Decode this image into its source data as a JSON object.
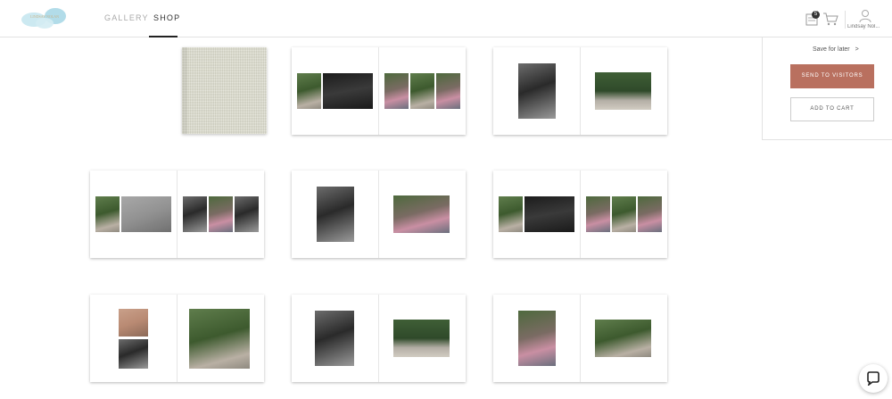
{
  "brand": {
    "logo_text": "LINDSAY NOLAN"
  },
  "nav": {
    "items": [
      {
        "label": "GALLERY"
      },
      {
        "label": "SHOP"
      }
    ]
  },
  "header": {
    "favorites_count": "5",
    "user_name": "Lindsay Nol..."
  },
  "sidepanel": {
    "save_label": "Save for later",
    "save_chevron": ">",
    "send_label": "SEND TO VISITORS",
    "cart_label": "ADD TO CART"
  },
  "colors": {
    "accent": "#b9705f",
    "nav_active": "#222222",
    "badge": "#333333"
  },
  "icons": [
    "favorites-icon",
    "cart-icon",
    "user-icon",
    "chat-icon"
  ]
}
